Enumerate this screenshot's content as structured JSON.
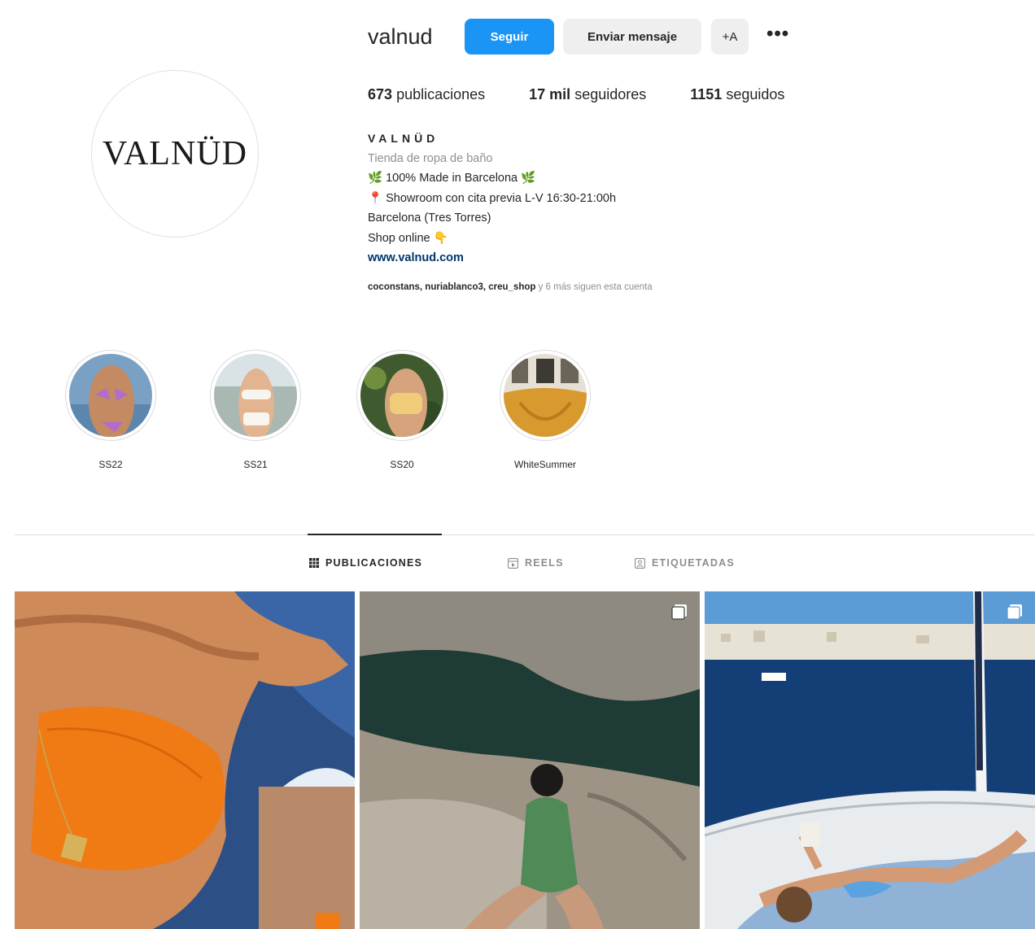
{
  "profile": {
    "username": "valnud",
    "avatar_text": "VALNÜD",
    "buttons": {
      "follow": "Seguir",
      "message": "Enviar mensaje",
      "suggest": "+A",
      "more": "•••"
    },
    "stats": {
      "posts_value": "673",
      "posts_label": "publicaciones",
      "followers_value": "17 mil",
      "followers_label": "seguidores",
      "following_value": "1151",
      "following_label": "seguidos"
    },
    "bio": {
      "name": "VALNÜD",
      "category": "Tienda de ropa de baño",
      "line1": "100% Made in Barcelona",
      "line2": "Showroom con cita previa L-V 16:30-21:00h",
      "line3": "Barcelona (Tres Torres)",
      "line4": "Shop online",
      "website": "www.valnud.com"
    },
    "followed_by": {
      "accounts": "coconstans, nuriablanco3, creu_shop",
      "rest": " y 6 más siguen esta cuenta"
    }
  },
  "highlights": [
    {
      "label": "SS22"
    },
    {
      "label": "SS21"
    },
    {
      "label": "SS20"
    },
    {
      "label": "WhiteSummer"
    }
  ],
  "tabs": [
    {
      "label": "PUBLICACIONES",
      "icon": "grid-icon",
      "active": true
    },
    {
      "label": "REELS",
      "icon": "reels-icon",
      "active": false
    },
    {
      "label": "ETIQUETADAS",
      "icon": "tagged-icon",
      "active": false
    }
  ],
  "posts": [
    {
      "icon": "none"
    },
    {
      "icon": "multiple-photos-icon"
    },
    {
      "icon": "multiple-photos-icon"
    }
  ],
  "colors": {
    "follow_button": "#1a95f5",
    "secondary_button": "#efefef",
    "link": "#00376b"
  }
}
